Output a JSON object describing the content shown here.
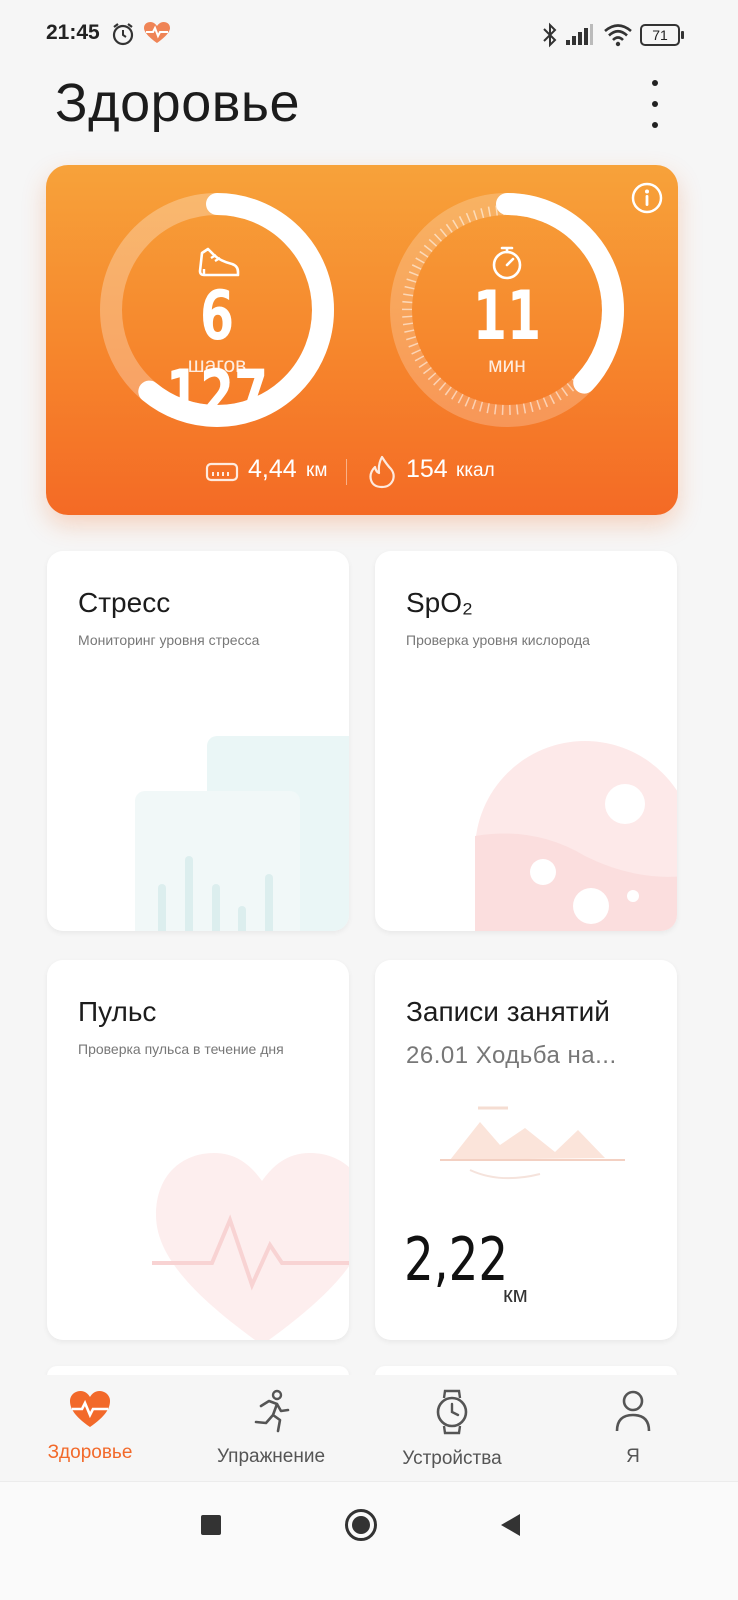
{
  "status_bar": {
    "time": "21:45",
    "icons": [
      "alarm-icon",
      "health-heart-icon",
      "bluetooth-icon",
      "signal-icon",
      "wifi-icon",
      "battery-icon"
    ],
    "battery": "71"
  },
  "header": {
    "title": "Здоровье",
    "menu_icon": "more-vertical-icon"
  },
  "activity": {
    "steps_value": "6 127",
    "steps_unit": "шагов",
    "steps_progress": 0.61,
    "minutes_value": "11",
    "minutes_unit": "мин",
    "minutes_progress": 0.37,
    "distance_value": "4,44",
    "distance_unit": "км",
    "calories_value": "154",
    "calories_unit": "ккал",
    "info_icon": "info-icon",
    "colors": {
      "gradient_top": "#f7a23a",
      "gradient_bottom": "#f46a25"
    }
  },
  "cards": {
    "stress": {
      "title": "Стресс",
      "subtitle": "Мониторинг уровня стресса"
    },
    "spo2": {
      "title": "SpO₂",
      "subtitle": "Проверка уровня кислорода"
    },
    "pulse": {
      "title": "Пульс",
      "subtitle": "Проверка пульса в течение дня"
    },
    "workouts": {
      "title": "Записи занятий",
      "subtitle": "26.01 Ходьба на...",
      "value": "2,22",
      "unit": "км"
    }
  },
  "bottom_nav": {
    "items": [
      {
        "label": "Здоровье",
        "icon": "heart-icon",
        "active": true
      },
      {
        "label": "Упражнение",
        "icon": "running-icon",
        "active": false
      },
      {
        "label": "Устройства",
        "icon": "watch-icon",
        "active": false
      },
      {
        "label": "Я",
        "icon": "person-icon",
        "active": false
      }
    ],
    "accent": "#f2692a"
  },
  "system_nav": {
    "icons": [
      "recents-square-icon",
      "home-circle-icon",
      "back-triangle-icon"
    ]
  }
}
